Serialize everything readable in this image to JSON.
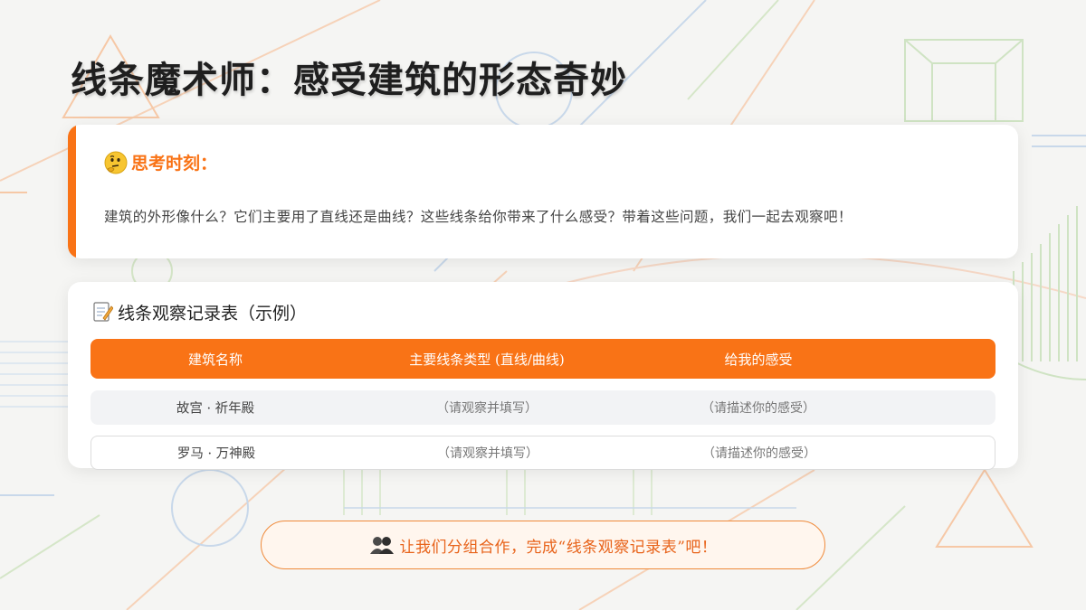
{
  "title": "线条魔术师：感受建筑的形态奇妙",
  "thinking": {
    "icon": "thinking-face-icon",
    "heading": "思考时刻：",
    "text": "建筑的外形像什么？它们主要用了直线还是曲线？这些线条给你带来了什么感受？带着这些问题，我们一起去观察吧！"
  },
  "table": {
    "icon": "memo-icon",
    "heading": "线条观察记录表（示例）",
    "columns": [
      "建筑名称",
      "主要线条类型 (直线/曲线)",
      "给我的感受"
    ],
    "rows": [
      [
        "故宫 · 祈年殿",
        "（请观察并填写）",
        "（请描述你的感受）"
      ],
      [
        "罗马 · 万神殿",
        "（请观察并填写）",
        "（请描述你的感受）"
      ]
    ]
  },
  "cta": {
    "icon": "group-people-icon",
    "text": "让我们分组合作，完成“线条观察记录表”吧！"
  },
  "colors": {
    "accent": "#f97316",
    "background": "#f5f5f3",
    "row_alt": "#f2f3f5"
  }
}
